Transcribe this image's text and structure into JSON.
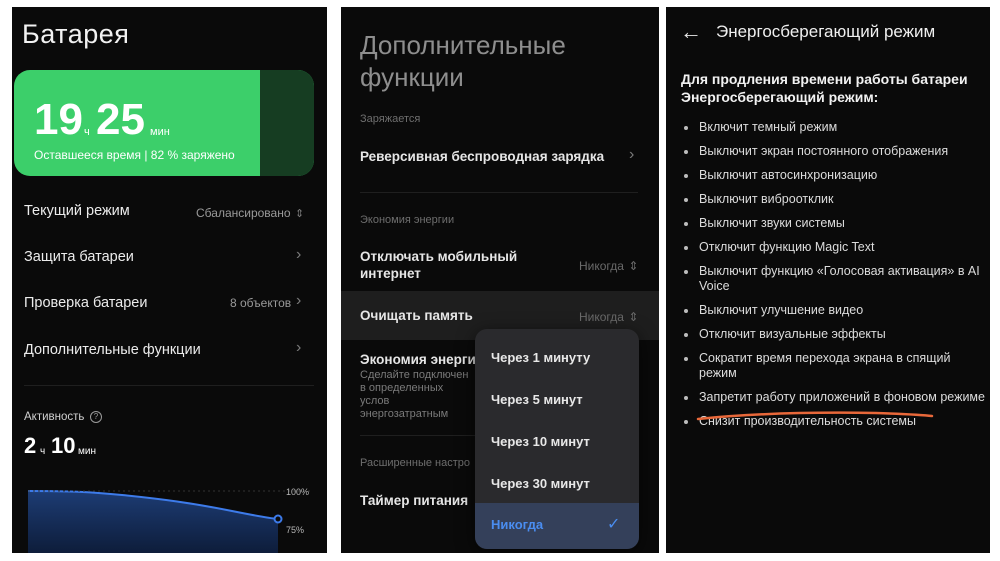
{
  "panel1": {
    "title": "Батарея",
    "battery": {
      "hours": "19",
      "hours_unit": "ч",
      "minutes": "25",
      "minutes_unit": "мин",
      "subtitle": "Оставшееся время | 82 % заряжено",
      "charge_fraction": 0.82,
      "color": "#3ccf6a"
    },
    "rows": [
      {
        "label": "Текущий режим",
        "value": "Сбалансировано",
        "icon": "updown-icon"
      },
      {
        "label": "Защита батареи",
        "value": "",
        "icon": "chevron-right-icon"
      },
      {
        "label": "Проверка батареи",
        "value": "8 объектов",
        "icon": "chevron-right-icon"
      },
      {
        "label": "Дополнительные функции",
        "value": "",
        "icon": "chevron-right-icon"
      }
    ],
    "activity": {
      "label": "Активность",
      "hours": "2",
      "hours_unit": "ч",
      "minutes": "10",
      "minutes_unit": "мин",
      "tick_top": "100%",
      "tick_bottom": "75%"
    }
  },
  "panel2": {
    "title": "Дополнительные функции",
    "section_charging": "Заряжается",
    "reverse_charging": "Реверсивная беспроводная зарядка",
    "section_energy": "Экономия энергии",
    "mobile_data": {
      "label": "Отключать мобильный интернет",
      "value": "Никогда"
    },
    "clear_memory": {
      "label": "Очищать память",
      "value": "Никогда"
    },
    "energy_saving": {
      "label": "Экономия энерги",
      "description": "Сделайте подключен в определенных услов энергозатратным"
    },
    "section_advanced": "Расширенные настро",
    "power_timer": "Таймер питания",
    "dropdown": {
      "options": [
        "Через 1 минуту",
        "Через 5 минут",
        "Через 10 минут",
        "Через 30 минут",
        "Никогда"
      ],
      "selected": "Никогда",
      "accent": "#4a8df0"
    }
  },
  "panel3": {
    "title": "Энергосберегающий режим",
    "intro": "Для продления времени работы батареи Энергосберегающий режим:",
    "items": [
      "Включит темный режим",
      "Выключит экран постоянного отображения",
      "Выключит автосинхронизацию",
      "Выключит виброотклик",
      "Выключит звуки системы",
      "Отключит функцию Magic Text",
      "Выключит функцию «Голосовая активация» в AI Voice",
      "Выключит улучшение видео",
      "Отключит визуальные эффекты",
      "Сократит время перехода экрана в спящий режим",
      "Запретит работу приложений в фоновом режиме",
      "Снизит производительность системы"
    ],
    "highlight_color": "#e8683a"
  }
}
